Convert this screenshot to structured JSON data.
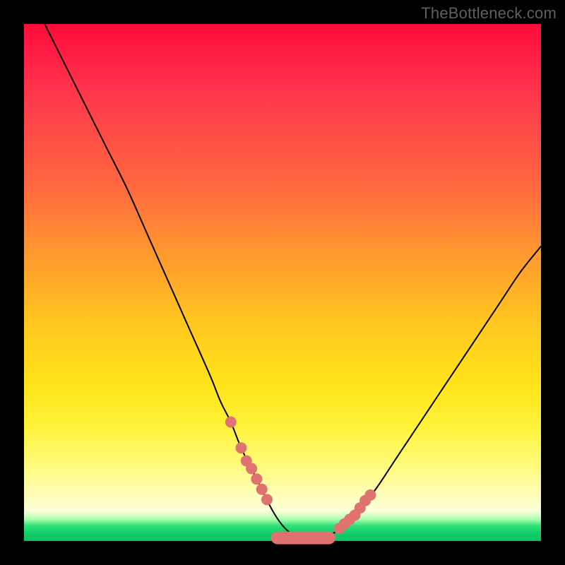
{
  "watermark": "TheBottleneck.com",
  "chart_data": {
    "type": "line",
    "title": "",
    "xlabel": "",
    "ylabel": "",
    "xlim": [
      0,
      100
    ],
    "ylim": [
      0,
      100
    ],
    "grid": false,
    "legend": false,
    "series": [
      {
        "name": "bottleneck-curve",
        "x": [
          4,
          8,
          12,
          16,
          20,
          24,
          28,
          32,
          36,
          38,
          40,
          42,
          44,
          46,
          48,
          50,
          52,
          54,
          56,
          58,
          60,
          64,
          68,
          72,
          76,
          80,
          84,
          88,
          92,
          96,
          100
        ],
        "y": [
          100,
          92,
          84,
          76,
          68,
          59,
          50,
          41,
          32,
          27,
          23,
          18,
          14,
          10,
          6,
          3,
          1.2,
          0.4,
          0.2,
          0.4,
          1.6,
          5,
          10,
          16,
          22,
          28,
          34,
          40,
          46,
          52,
          57
        ]
      }
    ],
    "markers": {
      "name": "highlight-beads",
      "color": "#e0736f",
      "left_cluster": {
        "x": [
          40,
          42,
          43,
          44,
          45,
          46,
          47
        ],
        "y": [
          23,
          18,
          15.5,
          14,
          12,
          10,
          8
        ]
      },
      "valley_capsule": {
        "x_start": 49,
        "x_end": 59,
        "y": 0.6
      },
      "right_cluster": {
        "x": [
          61,
          62,
          63,
          64,
          65,
          66,
          67
        ],
        "y": [
          2.4,
          3.3,
          4.2,
          5,
          6.4,
          7.8,
          8.9
        ]
      }
    }
  }
}
